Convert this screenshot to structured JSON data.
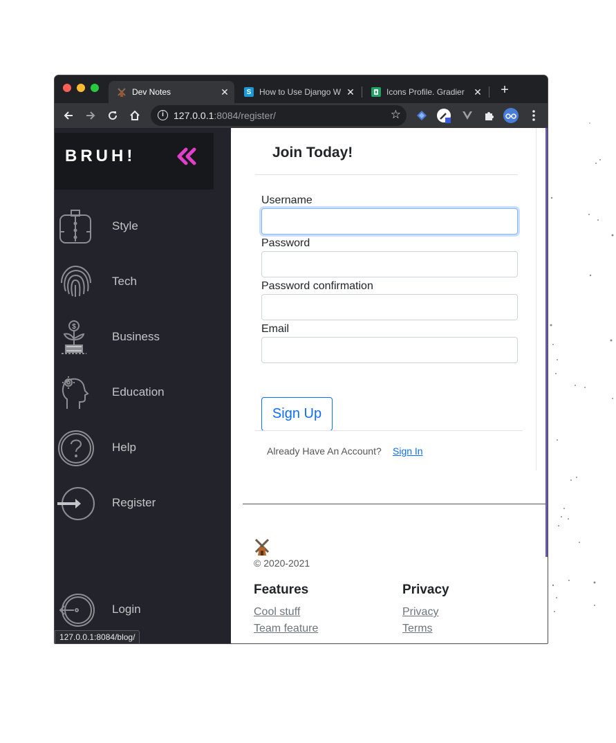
{
  "browser": {
    "tabs": [
      {
        "title": "Dev Notes",
        "favicon": "windmill-icon",
        "active": true
      },
      {
        "title": "How to Use Django W",
        "favicon": "S",
        "favicon_color": "#1a9bd7",
        "active": false
      },
      {
        "title": "Icons Profile. Gradier",
        "favicon": "plus-square-icon",
        "favicon_color": "#1fa463",
        "active": false
      }
    ],
    "url_host": "127.0.0.1",
    "url_rest": ":8084/register/",
    "status_url": "127.0.0.1:8084/blog/"
  },
  "sidebar": {
    "brand": "BRUH!",
    "items": [
      {
        "label": "Style",
        "icon": "shirt-icon"
      },
      {
        "label": "Tech",
        "icon": "fingerprint-icon"
      },
      {
        "label": "Business",
        "icon": "money-plant-icon"
      },
      {
        "label": "Education",
        "icon": "head-gear-icon"
      },
      {
        "label": "Help",
        "icon": "question-icon"
      },
      {
        "label": "Register",
        "icon": "sign-in-icon"
      },
      {
        "label": "Login",
        "icon": "login-icon"
      }
    ]
  },
  "form": {
    "title": "Join Today!",
    "fields": [
      {
        "label": "Username",
        "value": ""
      },
      {
        "label": "Password",
        "value": ""
      },
      {
        "label": "Password confirmation",
        "value": ""
      },
      {
        "label": "Email",
        "value": ""
      }
    ],
    "submit_label": "Sign Up",
    "already_text": "Already Have An Account?",
    "signin_label": "Sign In"
  },
  "footer": {
    "copyright": "© 2020-2021",
    "features_heading": "Features",
    "features_links": [
      "Cool stuff",
      "Team feature"
    ],
    "privacy_heading": "Privacy",
    "privacy_links": [
      "Privacy",
      "Terms"
    ]
  },
  "colors": {
    "sidebar_bg": "#23242b",
    "accent_pink": "#e040c8",
    "link_blue": "#0d6efd",
    "right_bar": "#6b57b6"
  }
}
